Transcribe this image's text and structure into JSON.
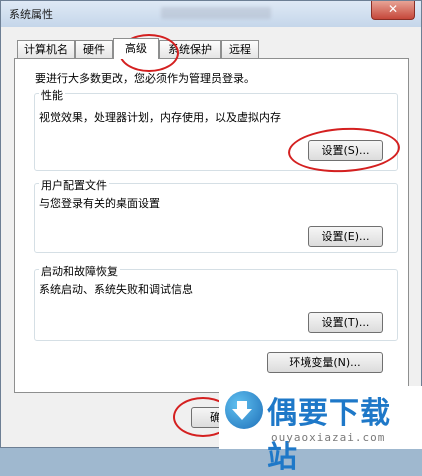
{
  "window": {
    "title": "系统属性",
    "close_label": "✕"
  },
  "tabs": [
    {
      "label": "计算机名",
      "active": false
    },
    {
      "label": "硬件",
      "active": false
    },
    {
      "label": "高级",
      "active": true
    },
    {
      "label": "系统保护",
      "active": false
    },
    {
      "label": "远程",
      "active": false
    }
  ],
  "advanced": {
    "intro": "要进行大多数更改，您必须作为管理员登录。",
    "performance": {
      "label": "性能",
      "description": "视觉效果，处理器计划，内存使用，以及虚拟内存",
      "button": "设置(S)..."
    },
    "user_profiles": {
      "label": "用户配置文件",
      "description": "与您登录有关的桌面设置",
      "button": "设置(E)..."
    },
    "startup_recovery": {
      "label": "启动和故障恢复",
      "description": "系统启动、系统失败和调试信息",
      "button": "设置(T)..."
    },
    "env_button": "环境变量(N)..."
  },
  "footer": {
    "ok_button": "确定"
  },
  "watermark": {
    "site_name": "偶要下载站",
    "url": "ouyaoxiazai.com"
  },
  "colors": {
    "annotation": "#d42020",
    "logo_blue": "#1e78c8"
  }
}
